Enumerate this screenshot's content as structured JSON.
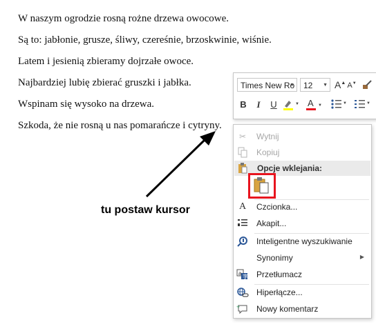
{
  "document": {
    "lines": [
      "W naszym ogrodzie rosną rożne drzewa owocowe.",
      "Są to: jabłonie, grusze, śliwy, czereśnie, brzoskwinie, wiśnie.",
      "Latem i jesienią zbieramy dojrzałe owoce.",
      "Najbardziej lubię zbierać gruszki i jabłka.",
      "Wspinam się wysoko na drzewa.",
      "Szkoda, że nie rosną u nas pomarańcze i cytryny."
    ]
  },
  "annotation": {
    "label": "tu postaw kursor"
  },
  "mini_toolbar": {
    "font_name": "Times New Ro",
    "font_size": "12",
    "bold": "B",
    "italic": "I",
    "underline": "U",
    "grow_font": "A",
    "shrink_font": "A",
    "font_color": "A",
    "highlight_color": "#ffff00",
    "font_color_value": "#e8141e"
  },
  "context_menu": {
    "items": [
      {
        "label": "Wytnij",
        "icon": "scissors-icon",
        "disabled": true
      },
      {
        "label": "Kopiuj",
        "icon": "copy-icon",
        "disabled": true
      },
      {
        "label": "Opcje wklejania:",
        "icon": "clipboard-icon",
        "disabled": false
      },
      {
        "label": "Czcionka...",
        "icon": "font-icon",
        "disabled": false
      },
      {
        "label": "Akapit...",
        "icon": "paragraph-icon",
        "disabled": false
      },
      {
        "label": "Inteligentne wyszukiwanie",
        "icon": "smart-lookup-icon",
        "disabled": false
      },
      {
        "label": "Synonimy",
        "icon": "",
        "disabled": false,
        "submenu": true
      },
      {
        "label": "Przetłumacz",
        "icon": "translate-icon",
        "disabled": false
      },
      {
        "label": "Hiperłącze...",
        "icon": "hyperlink-icon",
        "disabled": false
      },
      {
        "label": "Nowy komentarz",
        "icon": "comment-icon",
        "disabled": false
      }
    ]
  },
  "colors": {
    "highlight_box": "#e8141e",
    "icon_blue": "#2b5797"
  }
}
